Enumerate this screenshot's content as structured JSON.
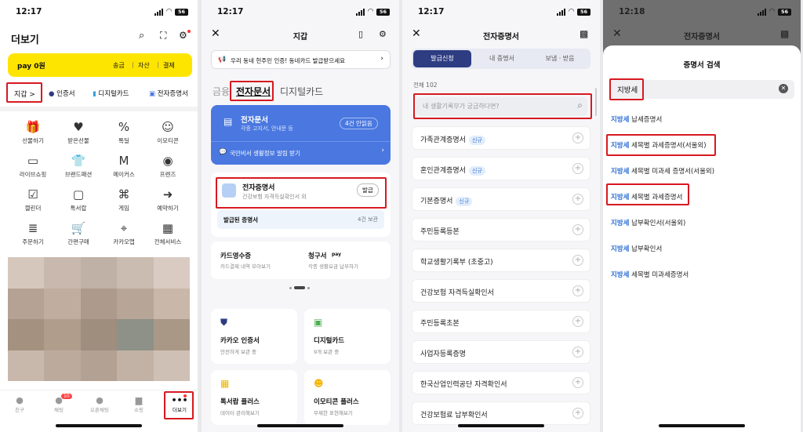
{
  "status": {
    "p1_time": "12:17",
    "p2_time": "12:17",
    "p3_time": "12:17",
    "p4_time": "12:18",
    "battery": "56"
  },
  "p1": {
    "title": "더보기",
    "pay_label": "pay 0원",
    "pay_links": [
      "송금",
      "|",
      "자산",
      "|",
      "결제"
    ],
    "chips": [
      "지갑 >",
      "인증서",
      "디지털카드",
      "전자증명서"
    ],
    "menu": [
      [
        "선물하기",
        "받은선물",
        "톡딜",
        "이모티콘"
      ],
      [
        "라이브쇼핑",
        "브랜드패션",
        "메이커스",
        "프렌즈"
      ],
      [
        "캘린더",
        "톡서랍",
        "게임",
        "예약하기"
      ],
      [
        "주문하기",
        "간편구매",
        "카카오맵",
        "전체서비스"
      ]
    ],
    "bottom_tabs": [
      "친구",
      "채팅",
      "오픈채팅",
      "쇼핑",
      "더보기"
    ],
    "chat_badge": "10"
  },
  "p2": {
    "title": "지갑",
    "banner": "우리 동네 헌주민 인증! 동네카드 발급받으세요",
    "tabs": [
      "금융",
      "전자문서",
      "디지털카드"
    ],
    "doc_card": {
      "title": "전자문서",
      "subtitle": "각종 고지서, 안내문 등",
      "badge": "4건 안읽음",
      "footer": "국민비서 생활정보 알림 받기"
    },
    "cert": {
      "title": "전자증명서",
      "subtitle": "건강보험 자격득실확인서 외",
      "button": "발급"
    },
    "issued": {
      "label": "발급된 증명서",
      "count": "4건 보관"
    },
    "receipts": [
      {
        "title": "카드영수증",
        "sub": "카드결제 내역 모아보기"
      },
      {
        "title": "청구서",
        "sub": "각종 생활요금 납부하기",
        "badge": "pay"
      }
    ],
    "tiles": [
      {
        "title": "카카오 인증서",
        "sub": "안전하게 보관 중"
      },
      {
        "title": "디지털카드",
        "sub": "9개 보관 중"
      },
      {
        "title": "톡서랍 플러스",
        "sub": "데이터 관리해보기"
      },
      {
        "title": "이모티콘 플러스",
        "sub": "무제한 표현해보기"
      }
    ]
  },
  "p3": {
    "title": "전자증명서",
    "segments": [
      "발급신청",
      "내 증명서",
      "보냄 · 받음"
    ],
    "total": "전체 102",
    "search_placeholder": "내 생활기록부가 궁금하다면?",
    "new_tag": "신규",
    "items": [
      {
        "name": "가족관계증명서",
        "isNew": "신규"
      },
      {
        "name": "혼인관계증명서",
        "isNew": "신규"
      },
      {
        "name": "기본증명서",
        "isNew": "신규"
      },
      {
        "name": "주민등록등본",
        "isNew": ""
      },
      {
        "name": "학교생활기록부 (초중고)",
        "isNew": ""
      },
      {
        "name": "건강보험 자격득실확인서",
        "isNew": ""
      },
      {
        "name": "주민등록초본",
        "isNew": ""
      },
      {
        "name": "사업자등록증명",
        "isNew": ""
      },
      {
        "name": "한국산업인력공단 자격확인서",
        "isNew": ""
      },
      {
        "name": "건강보험료 납부확인서",
        "isNew": ""
      }
    ]
  },
  "p4": {
    "title": "전자증명서",
    "sheet_title": "증명서 검색",
    "query": "지방세",
    "results": [
      {
        "key": "지방세",
        "rest": " 납세증명서"
      },
      {
        "key": "지방세",
        "rest": " 세목별 과세증명서(서울외)"
      },
      {
        "key": "지방세",
        "rest": " 세목별 미과세 증명서(서울외)"
      },
      {
        "key": "지방세",
        "rest": " 세목별 과세증명서"
      },
      {
        "key": "지방세",
        "rest": " 납부확인서(서울외)"
      },
      {
        "key": "지방세",
        "rest": " 납부확인서"
      },
      {
        "key": "지방세",
        "rest": " 세목별 미과세증명서"
      }
    ]
  },
  "colors": {
    "kakao_yellow": "#fee500",
    "highlight_red": "#d71921",
    "accent_blue": "#4a78e0",
    "navy": "#2e3c82"
  }
}
